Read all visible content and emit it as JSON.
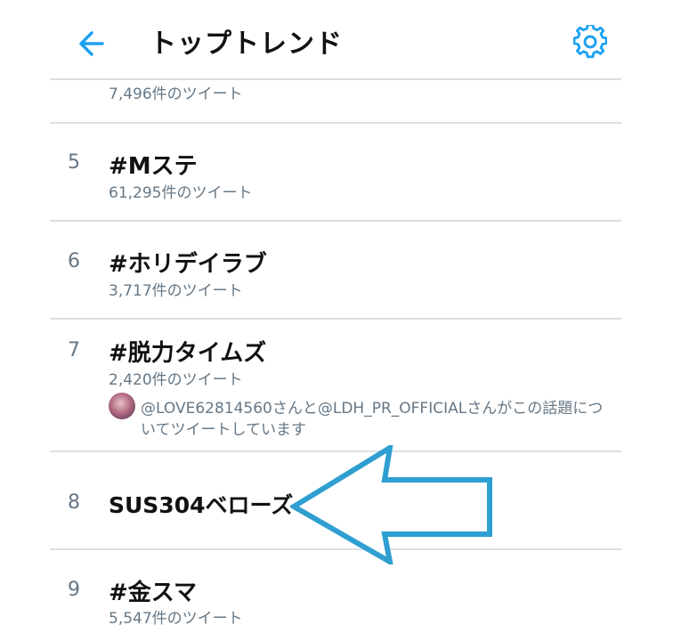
{
  "header": {
    "title": "トップトレンド",
    "back_icon": "arrow-left-icon",
    "settings_icon": "gear-icon",
    "accent_color": "#1da1f2"
  },
  "trends": [
    {
      "rank": "",
      "name": "",
      "count": "7,496件のツイート"
    },
    {
      "rank": "5",
      "name": "#Mステ",
      "count": "61,295件のツイート"
    },
    {
      "rank": "6",
      "name": "#ホリデイラブ",
      "count": "3,717件のツイート"
    },
    {
      "rank": "7",
      "name": "#脱力タイムズ",
      "count": "2,420件のツイート",
      "context_line_1": "@LOVE62814560さんと@LDH_PR_OFFICIALさんがこの話題につ",
      "context_line_2": "いてツイートしています"
    },
    {
      "rank": "8",
      "name": "SUS304ベローズ",
      "count": ""
    },
    {
      "rank": "9",
      "name": "#金スマ",
      "count": "5,547件のツイート"
    }
  ],
  "annotation": {
    "arrow_icon": "large-left-arrow",
    "arrow_color": "#2e9fd0"
  }
}
